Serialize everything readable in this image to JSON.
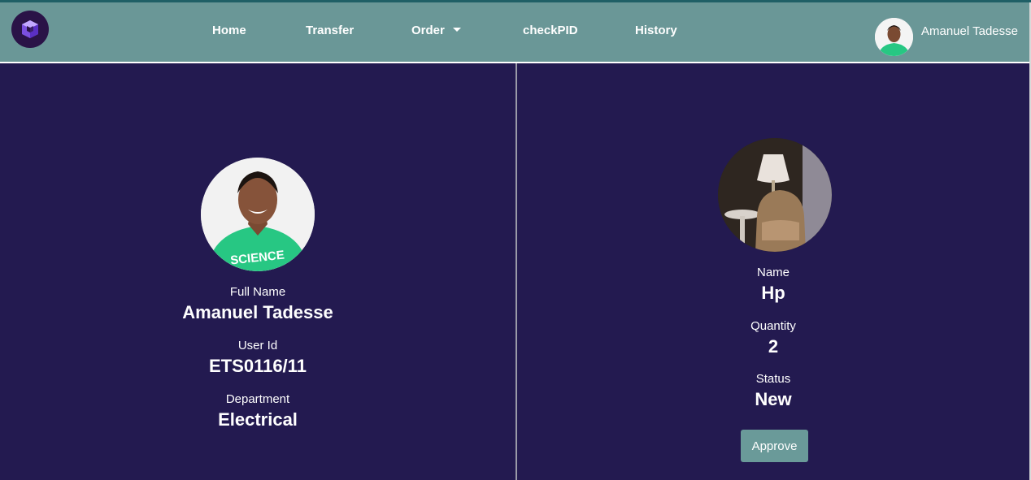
{
  "nav": {
    "items": [
      {
        "label": "Home"
      },
      {
        "label": "Transfer"
      },
      {
        "label": "Order"
      },
      {
        "label": "checkPID"
      },
      {
        "label": "History"
      }
    ],
    "user_name": "Amanuel Tadesse"
  },
  "profile": {
    "full_name_label": "Full Name",
    "full_name": "Amanuel Tadesse",
    "user_id_label": "User Id",
    "user_id": "ETS0116/11",
    "department_label": "Department",
    "department": "Electrical"
  },
  "order": {
    "name_label": "Name",
    "name": "Hp",
    "quantity_label": "Quantity",
    "quantity": "2",
    "status_label": "Status",
    "status": "New",
    "approve_label": "Approve"
  },
  "colors": {
    "navbar": "#6a9797",
    "panel": "#231a50",
    "button": "#6a9a99",
    "avatar_shirt": "#27c783"
  },
  "icons": {
    "logo": "cube-logo-icon",
    "order_dropdown": "chevron-down-icon"
  }
}
